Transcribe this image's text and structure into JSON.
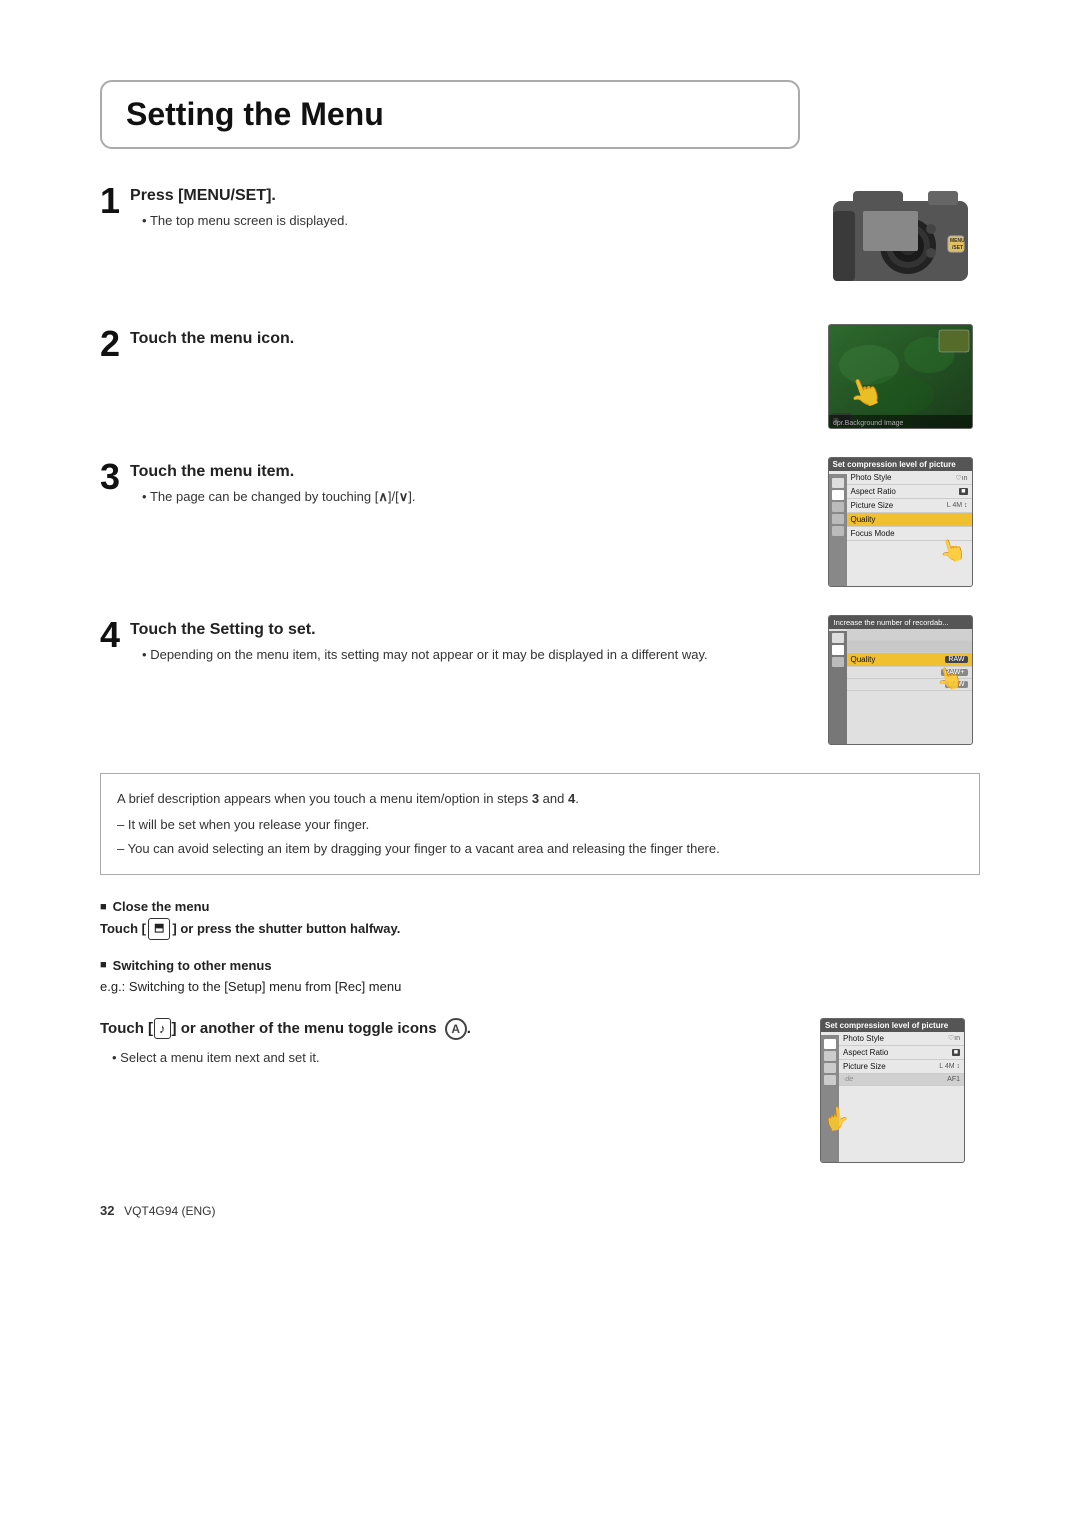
{
  "page": {
    "title": "Setting the Menu",
    "footer": "32",
    "footer_code": "VQT4G94 (ENG)"
  },
  "steps": [
    {
      "number": "1",
      "heading": "Press [MENU/SET].",
      "bullets": [
        "The top menu screen is displayed."
      ]
    },
    {
      "number": "2",
      "heading": "Touch the menu icon.",
      "bullets": []
    },
    {
      "number": "3",
      "heading": "Touch the menu item.",
      "bullets": [
        "The page can be changed by touching [∧]/[∨]."
      ]
    },
    {
      "number": "4",
      "heading": "Touch the Setting to set.",
      "bullets": [
        "Depending on the menu item, its setting may not appear or it may be displayed in a different way."
      ]
    }
  ],
  "notice": {
    "main": "A brief description appears when you touch a menu item/option in steps 3 and 4.",
    "sub1": "– It will be set when you release your finger.",
    "sub2": "– You can avoid selecting an item by dragging your finger to a vacant area and releasing the finger there."
  },
  "close_menu": {
    "heading": "Close the menu",
    "instruction": "Touch [⬜] or press the shutter button halfway."
  },
  "switching": {
    "heading": "Switching to other menus",
    "example": "e.g.: Switching to the [Setup] menu from [Rec] menu"
  },
  "toggle_section": {
    "heading_pre": "Touch [",
    "heading_icon": "♪",
    "heading_post": "] or another of the menu toggle icons",
    "circle_label": "A",
    "bullet": "Select a menu item next and set it."
  },
  "menu_screen_labels": {
    "header": "Set compression level of picture",
    "item1": "Photo Style",
    "item1_val": "♥ın",
    "item2": "Aspect Ratio",
    "item3": "Picture Size",
    "item3_val": "L 4M",
    "item4": "Quality",
    "item5": "Focus Mode",
    "chip_raw1": "RAW",
    "chip_raw2": "RAW+",
    "chip_raw3": "RAW"
  }
}
